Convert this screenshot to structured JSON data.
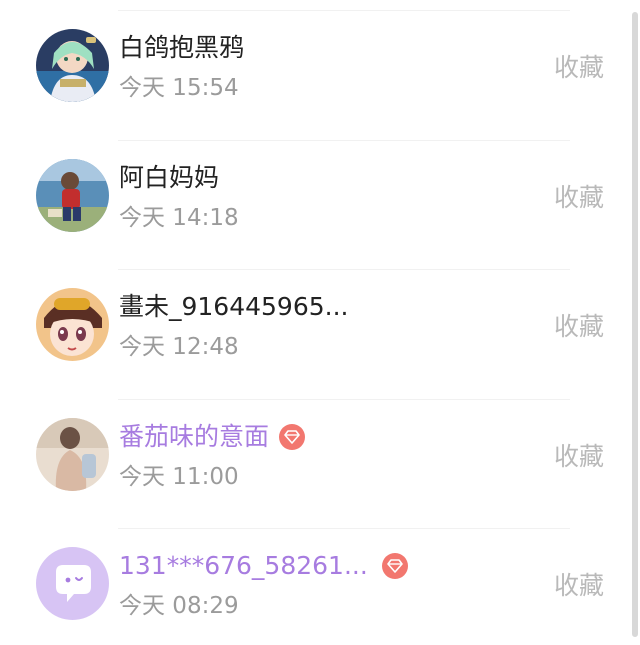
{
  "list": {
    "items": [
      {
        "name": "白鸽抱黑鸦",
        "time": "今天 15:54",
        "action": "收藏",
        "vip": false
      },
      {
        "name": "阿白妈妈",
        "time": "今天 14:18",
        "action": "收藏",
        "vip": false
      },
      {
        "name": "畫未_916445965...",
        "time": "今天 12:48",
        "action": "收藏",
        "vip": false
      },
      {
        "name": "番茄味的意面",
        "time": "今天 11:00",
        "action": "收藏",
        "vip": true
      },
      {
        "name": "131***676_58261...",
        "time": "今天 08:29",
        "action": "收藏",
        "vip": true
      }
    ]
  },
  "colors": {
    "vip_name": "#a77ce0",
    "vip_badge": "#f2776f",
    "action_text": "#b9b9b9",
    "time_text": "#9b9b9b"
  },
  "icons": {
    "vip": "diamond-icon",
    "avatar_default": "chat-bubble-icon"
  }
}
